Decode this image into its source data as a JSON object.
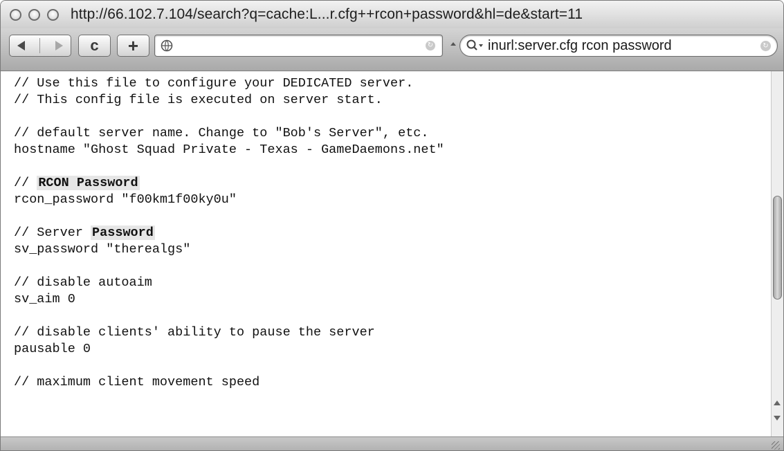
{
  "window": {
    "title": "http://66.102.7.104/search?q=cache:L...r.cfg++rcon+password&hl=de&start=11"
  },
  "toolbar": {
    "back_icon": "arrow-left-icon",
    "forward_icon": "arrow-right-icon",
    "reload_label": "c",
    "add_bookmark_label": "+",
    "address_value": "",
    "search_value": "inurl:server.cfg  rcon password"
  },
  "content": {
    "lines": [
      {
        "type": "text",
        "text": "// Use this file to configure your DEDICATED server."
      },
      {
        "type": "text",
        "text": "// This config file is executed on server start."
      },
      {
        "type": "blank"
      },
      {
        "type": "text",
        "text": "// default server name. Change to \"Bob's Server\", etc."
      },
      {
        "type": "text",
        "text": "hostname \"Ghost Squad Private - Texas - GameDaemons.net\""
      },
      {
        "type": "blank"
      },
      {
        "type": "rich",
        "segments": [
          {
            "text": "// "
          },
          {
            "text": "RCON Password",
            "highlight": true
          }
        ]
      },
      {
        "type": "text",
        "text": "rcon_password \"f00km1f00ky0u\""
      },
      {
        "type": "blank"
      },
      {
        "type": "rich",
        "segments": [
          {
            "text": "// Server "
          },
          {
            "text": "Password",
            "highlight": true
          }
        ]
      },
      {
        "type": "text",
        "text": "sv_password \"therealgs\""
      },
      {
        "type": "blank"
      },
      {
        "type": "text",
        "text": "// disable autoaim"
      },
      {
        "type": "text",
        "text": "sv_aim 0"
      },
      {
        "type": "blank"
      },
      {
        "type": "text",
        "text": "// disable clients' ability to pause the server"
      },
      {
        "type": "text",
        "text": "pausable 0"
      },
      {
        "type": "blank"
      },
      {
        "type": "text",
        "text": "// maximum client movement speed"
      }
    ]
  }
}
